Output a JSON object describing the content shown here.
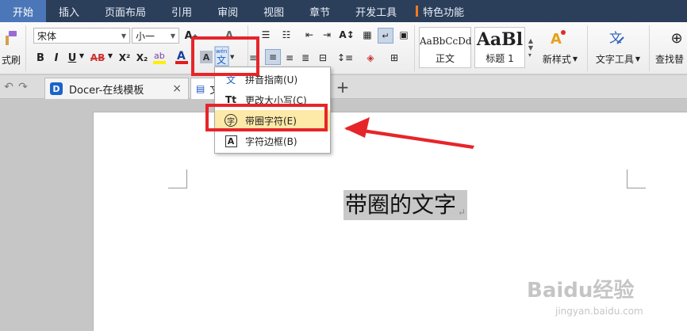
{
  "menu": {
    "tabs": [
      "开始",
      "插入",
      "页面布局",
      "引用",
      "审阅",
      "视图",
      "章节",
      "开发工具",
      "特色功能"
    ]
  },
  "ribbon": {
    "format_painter_label": "式刷",
    "font_name": "宋体",
    "font_size": "小一",
    "bold": "B",
    "italic": "I",
    "underline": "U",
    "strike": "AB",
    "superscript": "X²",
    "subscript": "X₂",
    "styles": [
      {
        "preview": "AaBbCcDd",
        "caption": "正文"
      },
      {
        "preview": "AaBl",
        "caption": "标题 1"
      }
    ],
    "new_style_label": "新样式",
    "text_tools_label": "文字工具",
    "find_replace_label": "查找替"
  },
  "tabs": {
    "docer_label": "Docer-在线模板",
    "doc_label_partial": "文",
    "add_label": "+"
  },
  "dropdown": {
    "items": [
      {
        "icon": "文",
        "label": "拼音指南(U)"
      },
      {
        "icon": "Tt",
        "label": "更改大小写(C)"
      },
      {
        "icon": "字",
        "label": "带圈字符(E)"
      },
      {
        "icon": "A",
        "label": "字符边框(B)"
      }
    ]
  },
  "document": {
    "text": "带圈的文字",
    "para_mark": "↵"
  },
  "watermark": {
    "brand": "Baidu经验",
    "url": "jingyan.baidu.com"
  }
}
